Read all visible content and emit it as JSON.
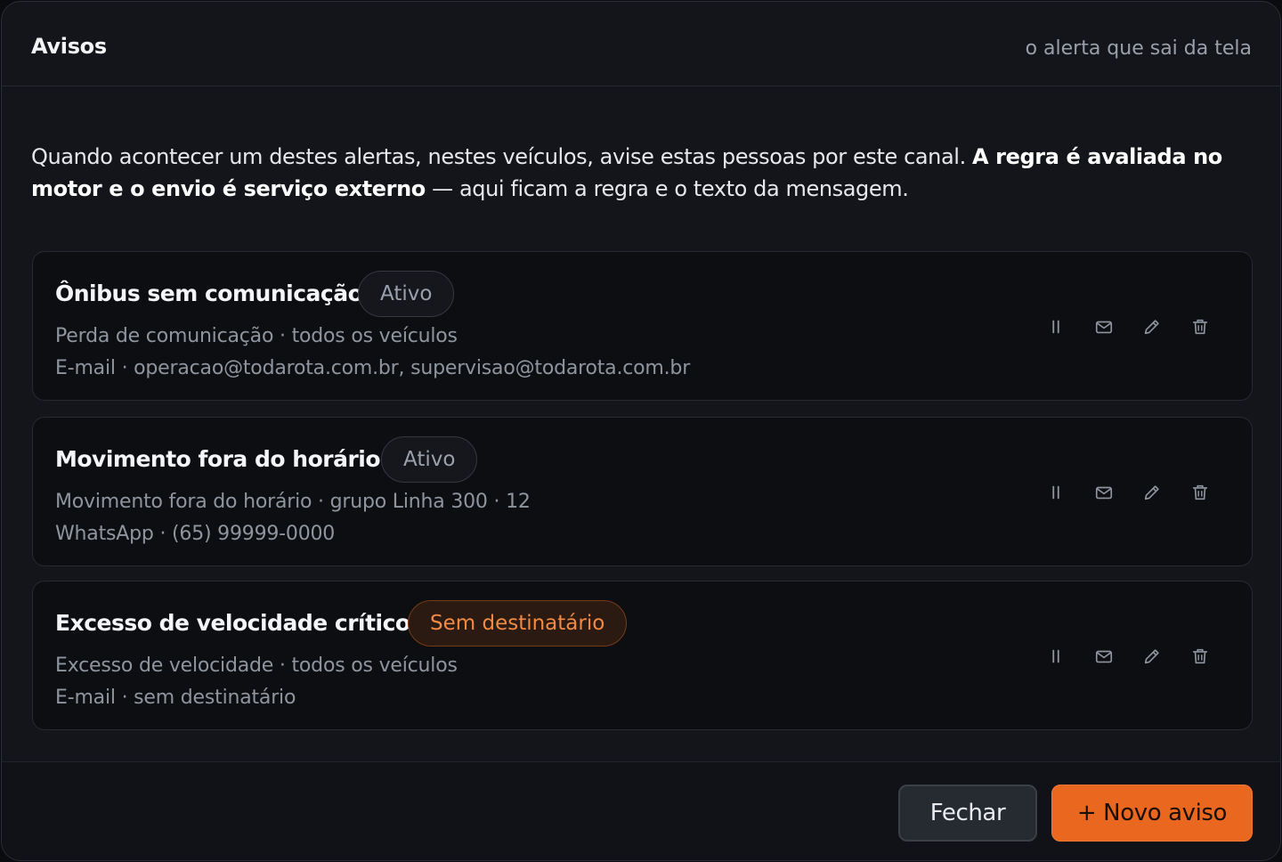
{
  "modal": {
    "title": "Avisos",
    "subtitle": "o alerta que sai da tela"
  },
  "intro": {
    "text_plain": "Quando acontecer um destes alertas, nestes veículos, avise estas pessoas por este canal. ",
    "text_bold": "A regra é avaliada no motor e o envio é serviço externo",
    "text_tail": " — aqui ficam a regra e o texto da mensagem."
  },
  "rules": [
    {
      "name": "Ônibus sem comunicação",
      "badge": "Ativo",
      "badge_kind": "neutral",
      "line1": "Perda de comunicação · todos os veículos",
      "line2": "E-mail · operacao@todarota.com.br, supervisao@todarota.com.br"
    },
    {
      "name": "Movimento fora do horário",
      "badge": "Ativo",
      "badge_kind": "neutral",
      "line1": "Movimento fora do horário · grupo Linha 300 · 12",
      "line2": "WhatsApp · (65) 99999-0000"
    },
    {
      "name": "Excesso de velocidade crítico",
      "badge": "Sem destinatário",
      "badge_kind": "warn",
      "line1": "Excesso de velocidade · todos os veículos",
      "line2": "E-mail · sem destinatário"
    }
  ],
  "row_actions": {
    "icons": [
      "pause-icon",
      "mail-icon",
      "edit-icon",
      "trash-icon"
    ]
  },
  "footer": {
    "close_label": "Fechar",
    "new_label": "+ Novo aviso"
  },
  "colors": {
    "accent": "#e9671f",
    "warn_text": "#f08a44",
    "background": "#13151a"
  }
}
